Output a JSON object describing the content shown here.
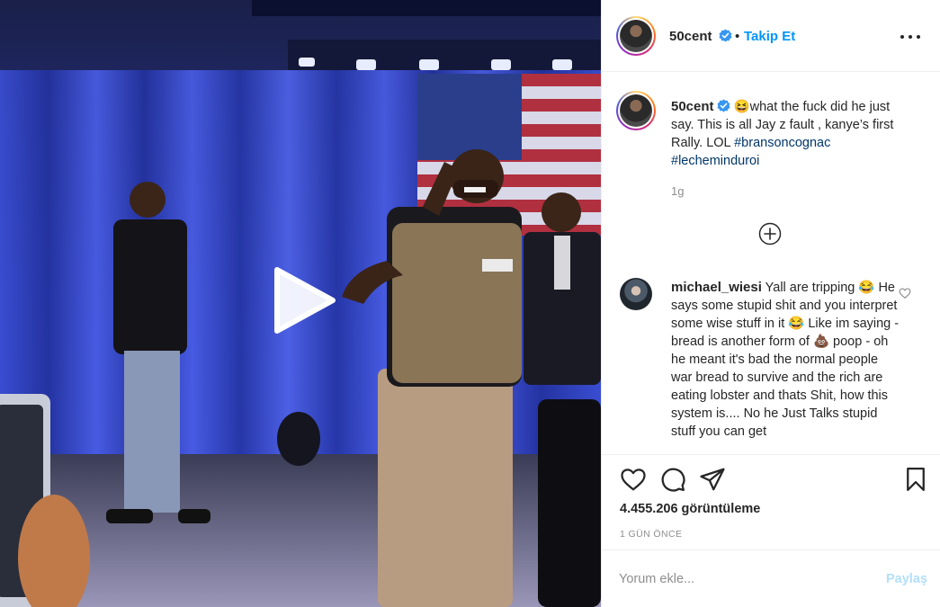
{
  "post": {
    "username": "50cent",
    "follow_separator": "•",
    "follow_label": "Takip Et",
    "caption_emoji": "😆",
    "caption_text": "what the fuck did he just say. This is all Jay z fault , kanye’s first Rally. LOL ",
    "hashtag_1": "#bransoncognac",
    "hashtag_2": "#lecheminduroi",
    "caption_time": "1g",
    "views": "4.455.206 görüntüleme",
    "date": "1 GÜN ÖNCE"
  },
  "comment": {
    "username": "michael_wiesi",
    "text": " Yall are tripping 😂 He says some stupid shit and you interpret some wise stuff in it 😂 Like im saying - bread is another form of 💩 poop - oh he meant it's bad the normal people war bread to survive and the rich are eating lobster and thats Shit, how this system is.... No he Just Talks stupid stuff you can get"
  },
  "composer": {
    "placeholder": "Yorum ekle...",
    "post_label": "Paylaş"
  },
  "icons": {
    "media": "play-icon",
    "more": "more-options-icon",
    "verified": "verified-badge-icon",
    "load": "load-more-icon",
    "like": "heart-icon",
    "comment": "comment-icon",
    "share": "share-icon",
    "save": "bookmark-icon"
  },
  "colors": {
    "link": "#0095f6",
    "hashtag": "#00376b",
    "muted": "#8e8e8e",
    "post_disabled": "#b2dffc"
  }
}
